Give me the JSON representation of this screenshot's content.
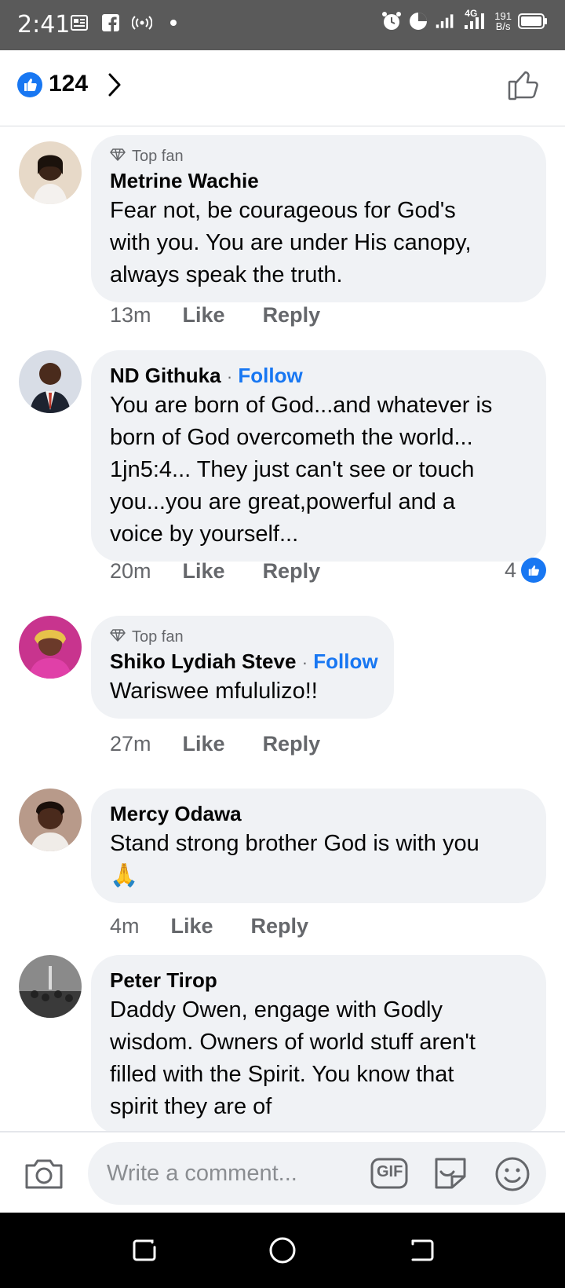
{
  "status_bar": {
    "time": "2:41",
    "network_type": "4G",
    "net_speed_value": "191",
    "net_speed_unit": "B/s"
  },
  "header": {
    "reaction_count": "124"
  },
  "comments": [
    {
      "badge": "Top fan",
      "author": "Metrine Wachie",
      "follow": "",
      "text_lines": [
        "Fear not, be courageous for God's",
        "with you. You are under His canopy,",
        "always speak the truth."
      ],
      "time": "13m",
      "like_label": "Like",
      "reply_label": "Reply",
      "reactions": ""
    },
    {
      "badge": "",
      "author": "ND Githuka",
      "follow": "Follow",
      "text_lines": [
        "You are born of God...and whatever is",
        "born of God overcometh the world...",
        "1jn5:4... They just can't see or touch",
        "you...you are great,powerful and a",
        "voice by yourself..."
      ],
      "time": "20m",
      "like_label": "Like",
      "reply_label": "Reply",
      "reactions": "4"
    },
    {
      "badge": "Top fan",
      "author": "Shiko Lydiah Steve",
      "follow": "Follow",
      "text_lines": [
        "Wariswee mfululizo!!"
      ],
      "time": "27m",
      "like_label": "Like",
      "reply_label": "Reply",
      "reactions": ""
    },
    {
      "badge": "",
      "author": "Mercy Odawa",
      "follow": "",
      "text_lines": [
        "Stand strong brother God is with you",
        "🙏"
      ],
      "time": "4m",
      "like_label": "Like",
      "reply_label": "Reply",
      "reactions": ""
    },
    {
      "badge": "",
      "author": "Peter Tirop",
      "follow": "",
      "text_lines": [
        "Daddy Owen, engage with Godly",
        "wisdom. Owners of world stuff aren't",
        "filled with the Spirit. You know that",
        "spirit they are of"
      ],
      "time": "",
      "like_label": "",
      "reply_label": "",
      "reactions": ""
    }
  ],
  "composer": {
    "placeholder": "Write a comment...",
    "gif_label": "GIF"
  },
  "colors": {
    "accent": "#1877f2",
    "bubble": "#f0f2f5",
    "secondary_text": "#65676b",
    "status_bar": "#5a5a5a"
  }
}
